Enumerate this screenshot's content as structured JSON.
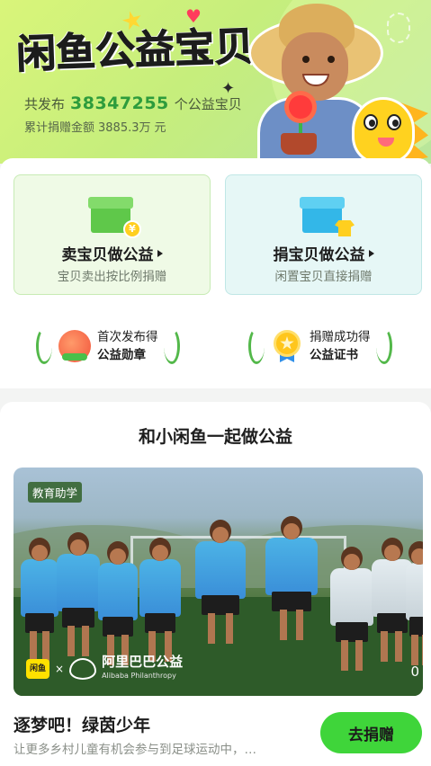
{
  "hero": {
    "title": "闲鱼公益宝贝",
    "published_prefix": "共发布",
    "published_count": "38347255",
    "published_suffix": "个公益宝贝",
    "donation_label": "累计捐赠金额",
    "donation_amount": "3885.3万",
    "donation_unit": "元"
  },
  "options": [
    {
      "title": "卖宝贝做公益",
      "subtitle": "宝贝卖出按比例捐赠",
      "icon": "sell-box-icon"
    },
    {
      "title": "捐宝贝做公益",
      "subtitle": "闲置宝贝直接捐赠",
      "icon": "donate-box-icon"
    }
  ],
  "awards": [
    {
      "line1": "首次发布得",
      "line2": "公益勋章",
      "icon": "charity-medal-icon"
    },
    {
      "line1": "捐赠成功得",
      "line2": "公益证书",
      "icon": "certificate-medal-icon"
    }
  ],
  "section": {
    "title": "和小闲鱼一起做公益"
  },
  "project": {
    "tag": "教育助学",
    "logo_fish": "闲鱼",
    "logo_x": "×",
    "logo_partner": "阿里巴巴公益",
    "logo_partner_en": "Alibaba Philanthropy",
    "corner_digit": "0",
    "title": "逐梦吧！绿茵少年",
    "description": "让更多乡村儿童有机会参与到足球运动中，…",
    "donate_button": "去捐赠"
  },
  "colors": {
    "accent_green": "#3fd53a",
    "count_green": "#2d9c3c",
    "sell_card_bg": "#effae6",
    "donate_card_bg": "#e6f7f6"
  }
}
